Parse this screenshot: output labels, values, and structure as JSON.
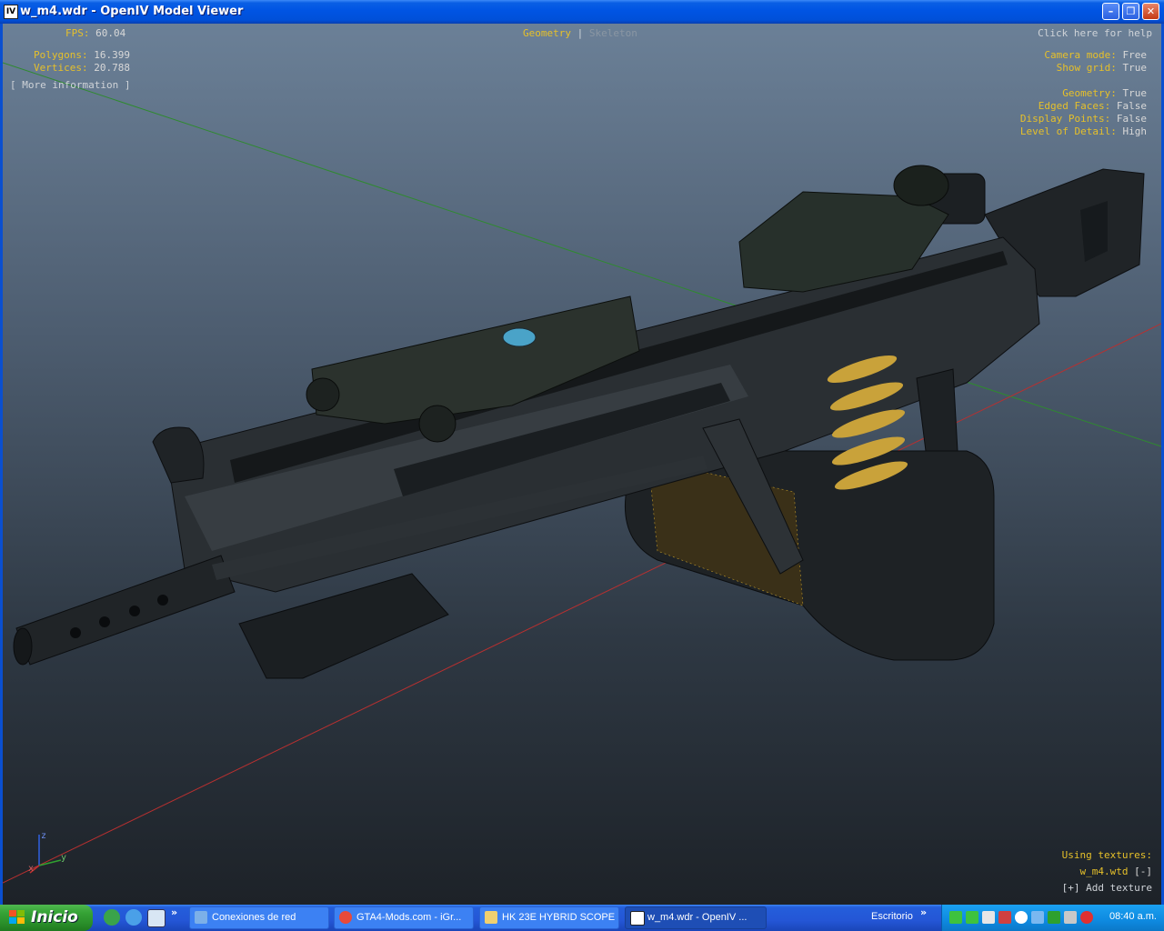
{
  "window": {
    "title": "w_m4.wdr - OpenIV Model Viewer",
    "icon_label": "IV",
    "minimize_glyph": "–",
    "maximize_glyph": "❐",
    "close_glyph": "✕"
  },
  "hud": {
    "fps_label": "FPS:",
    "fps_value": "60.04",
    "polygons_label": "Polygons:",
    "polygons_value": "16.399",
    "vertices_label": "Vertices:",
    "vertices_value": "20.788",
    "more_info": "[ More information ]",
    "mode_geometry": "Geometry",
    "mode_separator": "|",
    "mode_skeleton": "Skeleton",
    "help": "Click here for help",
    "camera_mode_label": "Camera mode:",
    "camera_mode_value": "Free",
    "show_grid_label": "Show grid:",
    "show_grid_value": "True",
    "geometry_label": "Geometry:",
    "geometry_value": "True",
    "edged_faces_label": "Edged Faces:",
    "edged_faces_value": "False",
    "display_points_label": "Display Points:",
    "display_points_value": "False",
    "lod_label": "Level of Detail:",
    "lod_value": "High",
    "using_textures": "Using textures:",
    "texture_file": "w_m4.wtd",
    "texture_toggle": "[-]",
    "add_texture": "[+] Add texture",
    "axis_z": "z",
    "axis_y": "y",
    "axis_x": "x"
  },
  "taskbar": {
    "start_label": "Inicio",
    "quicklaunch_more": "»",
    "tasks": [
      {
        "label": "Conexiones de red"
      },
      {
        "label": "GTA4-Mods.com - iGr..."
      },
      {
        "label": "HK 23E HYBRID SCOPE"
      },
      {
        "label": "w_m4.wdr - OpenIV ..."
      }
    ],
    "desktop_label": "Escritorio",
    "desktop_more": "»",
    "clock": "08:40 a.m."
  },
  "colors": {
    "hud_label": "#e6c02a",
    "hud_value": "#d8d8d8",
    "titlebar": "#0054e3",
    "start_green": "#36a336",
    "tray_blue": "#0e8ae0"
  }
}
